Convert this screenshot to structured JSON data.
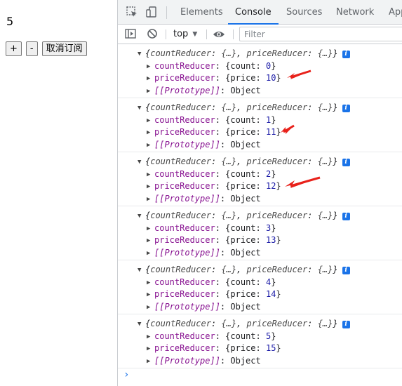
{
  "app": {
    "count": "5",
    "buttons": {
      "increment": "+",
      "decrement": "-",
      "unsubscribe": "取消订阅"
    }
  },
  "devtools": {
    "tabs": [
      "Elements",
      "Console",
      "Sources",
      "Network",
      "App"
    ],
    "active_tab": "Console",
    "toolbar": {
      "context": "top",
      "filter_placeholder": "Filter"
    },
    "accent_color": "#1a73e8",
    "annotation_arrow_color": "#e8211a"
  },
  "console": {
    "summary": {
      "open": "{",
      "key1": "countReducer",
      "sep": ": ",
      "ellipsis": "{…}",
      "comma": ", ",
      "key2": "priceReducer",
      "close": "}"
    },
    "count_key": "countReducer",
    "price_key": "priceReducer",
    "count_label": "count",
    "price_label": "price",
    "prototype_key": "[[Prototype]]",
    "prototype_value": "Object",
    "info_badge": "i",
    "entries": [
      {
        "count": "0",
        "price": "10"
      },
      {
        "count": "1",
        "price": "11"
      },
      {
        "count": "2",
        "price": "12"
      },
      {
        "count": "3",
        "price": "13"
      },
      {
        "count": "4",
        "price": "14"
      },
      {
        "count": "5",
        "price": "15"
      }
    ],
    "prompt": "›"
  }
}
